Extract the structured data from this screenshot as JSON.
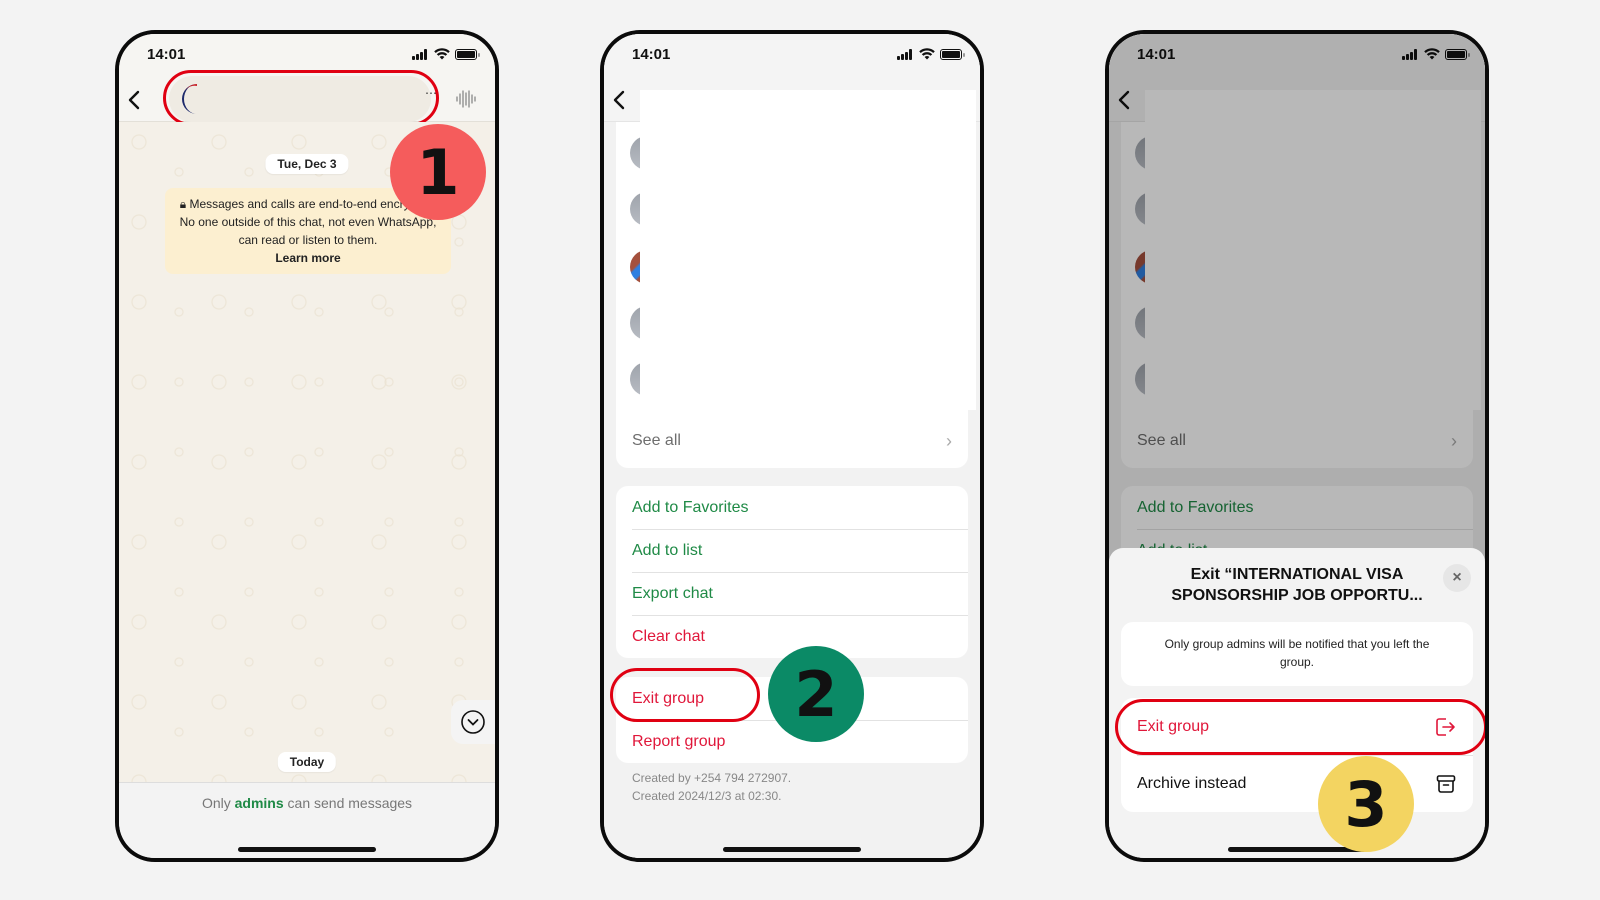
{
  "status": {
    "time": "14:01"
  },
  "steps": [
    "1",
    "2",
    "3"
  ],
  "colors": {
    "accent_green": "#1f8a46",
    "destructive_red": "#e0173a",
    "highlight_ring": "#e00012",
    "step1_badge": "#f55c5c",
    "step2_badge": "#0b8a66",
    "step3_badge": "#f3d461"
  },
  "chat": {
    "date_chip": "Tue, Dec 3",
    "encryption_note": "Messages and calls are end-to-end encrypted. No one outside of this chat, not even WhatsApp, can read or listen to them.",
    "learn_more": "Learn more",
    "today_chip": "Today",
    "footer_prefix": "Only",
    "footer_accent": "admins",
    "footer_suffix": "can send messages"
  },
  "group_info": {
    "see_all": "See all",
    "menu_section_1": [
      {
        "label": "Add to Favorites",
        "tone": "green"
      },
      {
        "label": "Add to list",
        "tone": "green"
      },
      {
        "label": "Export chat",
        "tone": "green"
      },
      {
        "label": "Clear chat",
        "tone": "red"
      }
    ],
    "menu_section_2": [
      {
        "label": "Exit group",
        "tone": "red"
      },
      {
        "label": "Report group",
        "tone": "red"
      }
    ],
    "created_by": "Created by +254 794 272907.",
    "created_at": "Created 2024/12/3 at 02:30."
  },
  "exit_sheet": {
    "title": "Exit “INTERNATIONAL VISA SPONSORSHIP JOB OPPORTU...",
    "note": "Only group admins will be notified that you left the group.",
    "exit_label": "Exit group",
    "archive_label": "Archive instead",
    "close_icon": "×"
  }
}
